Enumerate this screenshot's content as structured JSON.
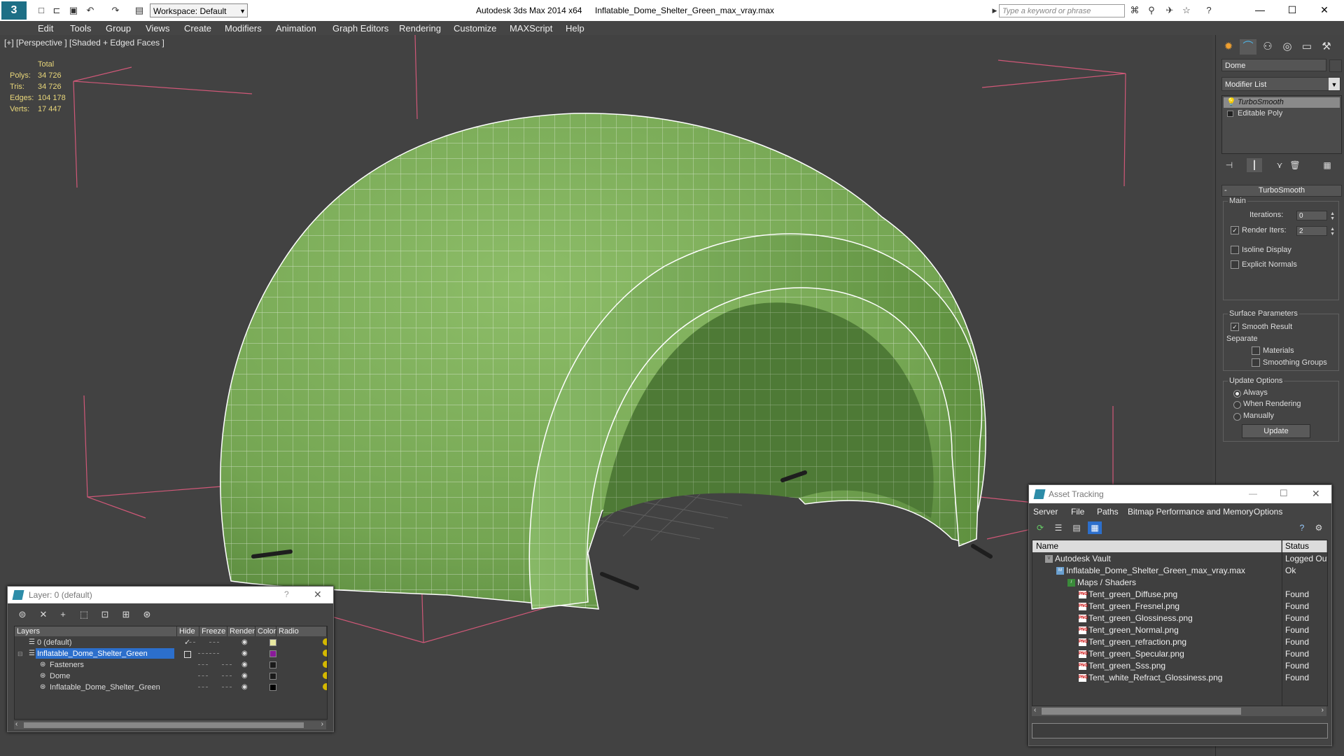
{
  "titlebar": {
    "app_title": "Autodesk 3ds Max  2014 x64",
    "file_title": "Inflatable_Dome_Shelter_Green_max_vray.max",
    "workspace": "Workspace: Default",
    "search_placeholder": "Type a keyword or phrase"
  },
  "menu": [
    "Edit",
    "Tools",
    "Group",
    "Views",
    "Create",
    "Modifiers",
    "Animation",
    "Graph Editors",
    "Rendering",
    "Customize",
    "MAXScript",
    "Help"
  ],
  "viewport": {
    "label": "[+] [Perspective ] [Shaded + Edged Faces ]",
    "stats_header": "Total",
    "stats": [
      {
        "key": "Polys:",
        "value": "34 726"
      },
      {
        "key": "Tris:",
        "value": "34 726"
      },
      {
        "key": "Edges:",
        "value": "104 178"
      },
      {
        "key": "Verts:",
        "value": "17 447"
      }
    ]
  },
  "command_panel": {
    "object_name": "Dome",
    "modifier_list": "Modifier List",
    "stack": [
      "TurboSmooth",
      "Editable Poly"
    ],
    "rollout_title": "TurboSmooth",
    "main_label": "Main",
    "iterations_label": "Iterations:",
    "iterations_value": "0",
    "render_iters_label": "Render Iters:",
    "render_iters_value": "2",
    "isoline_label": "Isoline Display",
    "explicit_normals_label": "Explicit Normals",
    "surface_params_label": "Surface Parameters",
    "smooth_result_label": "Smooth Result",
    "separate_label": "Separate",
    "materials_label": "Materials",
    "smoothing_groups_label": "Smoothing Groups",
    "update_options_label": "Update Options",
    "always_label": "Always",
    "when_rendering_label": "When Rendering",
    "manually_label": "Manually",
    "update_button": "Update"
  },
  "layer_window": {
    "title": "Layer: 0 (default)",
    "columns": [
      "Layers",
      "Hide",
      "Freeze",
      "Render",
      "Color",
      "Radio"
    ],
    "rows": [
      {
        "name": "0 (default)",
        "indent": 0,
        "color": "#e8e8a0",
        "selected": false
      },
      {
        "name": "Inflatable_Dome_Shelter_Green",
        "indent": 0,
        "color": "#8a1a9a",
        "selected": true
      },
      {
        "name": "Fasteners",
        "indent": 1,
        "color": "#1a1a1a",
        "selected": false
      },
      {
        "name": "Dome",
        "indent": 1,
        "color": "#1a1a1a",
        "selected": false
      },
      {
        "name": "Inflatable_Dome_Shelter_Green",
        "indent": 1,
        "color": "#000000",
        "selected": false
      }
    ]
  },
  "asset_window": {
    "title": "Asset Tracking",
    "menu": [
      "Server",
      "File",
      "Paths",
      "Bitmap Performance and Memory",
      "Options"
    ],
    "col_name": "Name",
    "col_status": "Status",
    "rows": [
      {
        "name": "Autodesk Vault",
        "status": "Logged Out",
        "indent": 0,
        "icon": "vault"
      },
      {
        "name": "Inflatable_Dome_Shelter_Green_max_vray.max",
        "status": "Ok",
        "indent": 1,
        "icon": "max"
      },
      {
        "name": "Maps / Shaders",
        "status": "",
        "indent": 2,
        "icon": "maps"
      },
      {
        "name": "Tent_green_Diffuse.png",
        "status": "Found",
        "indent": 3,
        "icon": "png"
      },
      {
        "name": "Tent_green_Fresnel.png",
        "status": "Found",
        "indent": 3,
        "icon": "png"
      },
      {
        "name": "Tent_green_Glossiness.png",
        "status": "Found",
        "indent": 3,
        "icon": "png"
      },
      {
        "name": "Tent_green_Normal.png",
        "status": "Found",
        "indent": 3,
        "icon": "png"
      },
      {
        "name": "Tent_green_refraction.png",
        "status": "Found",
        "indent": 3,
        "icon": "png"
      },
      {
        "name": "Tent_green_Specular.png",
        "status": "Found",
        "indent": 3,
        "icon": "png"
      },
      {
        "name": "Tent_green_Sss.png",
        "status": "Found",
        "indent": 3,
        "icon": "png"
      },
      {
        "name": "Tent_white_Refract_Glossiness.png",
        "status": "Found",
        "indent": 3,
        "icon": "png"
      }
    ]
  },
  "colors": {
    "dome_green": "#7aa85a",
    "selection_blue": "#2c6fcc",
    "stats_yellow": "#e9d77a"
  }
}
